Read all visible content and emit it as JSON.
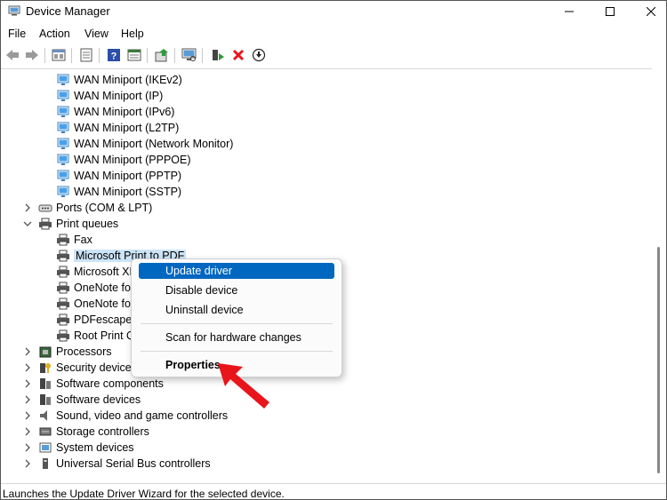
{
  "window": {
    "title": "Device Manager",
    "icon": "device-manager-icon"
  },
  "menu": [
    "File",
    "Action",
    "View",
    "Help"
  ],
  "toolbar": [
    "back-icon",
    "forward-icon",
    "properties-icon",
    "show-hidden-icon",
    "help-icon",
    "view-icon",
    "update-driver-icon",
    "scan-icon",
    "enable-device-icon",
    "uninstall-icon",
    "download-icon"
  ],
  "tree": [
    {
      "label": "WAN Miniport (IKEv2)",
      "type": "network"
    },
    {
      "label": "WAN Miniport (IP)",
      "type": "network"
    },
    {
      "label": "WAN Miniport (IPv6)",
      "type": "network"
    },
    {
      "label": "WAN Miniport (L2TP)",
      "type": "network"
    },
    {
      "label": "WAN Miniport (Network Monitor)",
      "type": "network"
    },
    {
      "label": "WAN Miniport (PPPOE)",
      "type": "network"
    },
    {
      "label": "WAN Miniport (PPTP)",
      "type": "network"
    },
    {
      "label": "WAN Miniport (SSTP)",
      "type": "network"
    },
    {
      "label": "Ports (COM & LPT)",
      "type": "port"
    },
    {
      "label": "Print queues",
      "type": "printer"
    },
    {
      "label": "Fax",
      "type": "printer"
    },
    {
      "label": "Microsoft Print to PDF",
      "type": "printer"
    },
    {
      "label": "Microsoft XPS Document Writer",
      "type": "printer"
    },
    {
      "label": "OneNote for Windows 10",
      "type": "printer"
    },
    {
      "label": "OneNote for Windows 10",
      "type": "printer"
    },
    {
      "label": "PDFescape Desktop Creator",
      "type": "printer"
    },
    {
      "label": "Root Print Queue",
      "type": "printer"
    },
    {
      "label": "Processors",
      "type": "processor"
    },
    {
      "label": "Security devices",
      "type": "security"
    },
    {
      "label": "Software components",
      "type": "software"
    },
    {
      "label": "Software devices",
      "type": "software"
    },
    {
      "label": "Sound, video and game controllers",
      "type": "sound"
    },
    {
      "label": "Storage controllers",
      "type": "storage"
    },
    {
      "label": "System devices",
      "type": "system"
    },
    {
      "label": "Universal Serial Bus controllers",
      "type": "usb"
    }
  ],
  "context_menu": {
    "update_driver": "Update driver",
    "disable_device": "Disable device",
    "uninstall_device": "Uninstall device",
    "scan": "Scan for hardware changes",
    "properties": "Properties"
  },
  "status": "Launches the Update Driver Wizard for the selected device.",
  "colors": {
    "accent": "#0067c0",
    "selection": "#cce4f7",
    "arrow": "#e8151b"
  }
}
